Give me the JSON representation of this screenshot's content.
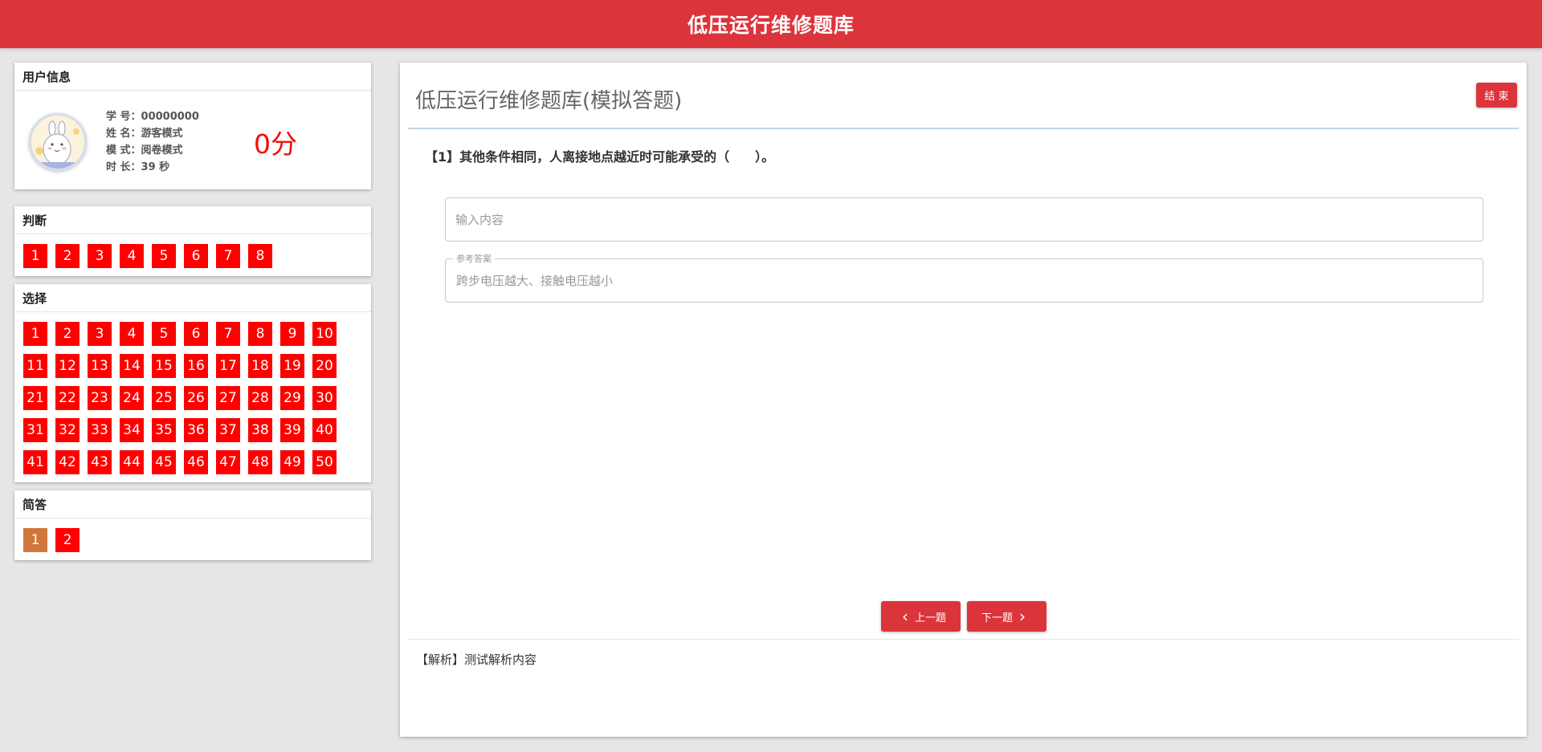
{
  "header": {
    "title": "低压运行维修题库"
  },
  "user_panel": {
    "heading": "用户信息",
    "student_id": "学 号：00000000",
    "name": "姓 名：游客模式",
    "mode": "模 式：阅卷模式",
    "duration": "时 长：39 秒",
    "score": "0分"
  },
  "judge_panel": {
    "heading": "判断",
    "items": [
      "1",
      "2",
      "3",
      "4",
      "5",
      "6",
      "7",
      "8"
    ]
  },
  "choice_panel": {
    "heading": "选择",
    "items": [
      "1",
      "2",
      "3",
      "4",
      "5",
      "6",
      "7",
      "8",
      "9",
      "10",
      "11",
      "12",
      "13",
      "14",
      "15",
      "16",
      "17",
      "18",
      "19",
      "20",
      "21",
      "22",
      "23",
      "24",
      "25",
      "26",
      "27",
      "28",
      "29",
      "30",
      "31",
      "32",
      "33",
      "34",
      "35",
      "36",
      "37",
      "38",
      "39",
      "40",
      "41",
      "42",
      "43",
      "44",
      "45",
      "46",
      "47",
      "48",
      "49",
      "50"
    ]
  },
  "short_panel": {
    "heading": "简答",
    "items": [
      "1",
      "2"
    ],
    "current_index": 0
  },
  "main": {
    "title": "低压运行维修题库(模拟答题)",
    "end_label": "结 束",
    "question": "【1】其他条件相同，人离接地点越近时可能承受的（　　）。",
    "answer_placeholder": "输入内容",
    "reference_label": "参考答案",
    "reference_text": "跨步电压越大、接触电压越小",
    "prev_label": "上一题",
    "next_label": "下一题",
    "analysis": "【解析】测试解析内容"
  },
  "colors": {
    "brand_red": "#dc343b",
    "question_button": "#fe0000",
    "current_question": "#d0773c",
    "score": "#f20d0d"
  }
}
